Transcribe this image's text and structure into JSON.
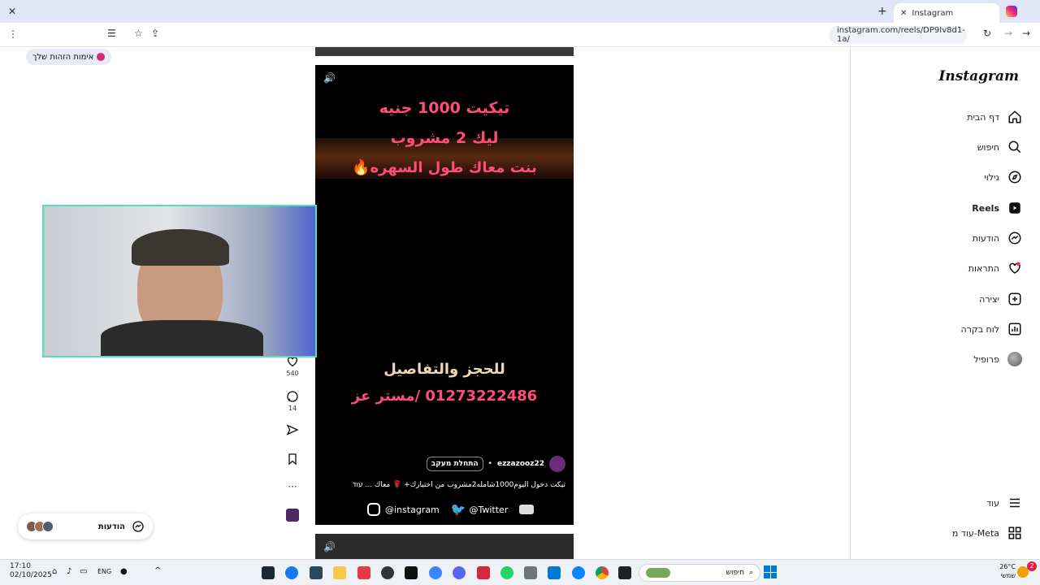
{
  "browser": {
    "tab_title": "Instagram",
    "url": "instagram.com/reels/DP9Iv8d1-1a/",
    "profile_chip": "אימות הזהות שלך"
  },
  "sidebar": {
    "logo": "Instagram",
    "items": [
      {
        "label": "דף הבית",
        "icon": "home-icon"
      },
      {
        "label": "חיפוש",
        "icon": "search-icon"
      },
      {
        "label": "גילוי",
        "icon": "compass-icon"
      },
      {
        "label": "Reels",
        "icon": "reels-icon"
      },
      {
        "label": "הודעות",
        "icon": "messenger-icon"
      },
      {
        "label": "התראות",
        "icon": "heart-icon"
      },
      {
        "label": "יצירה",
        "icon": "plus-square-icon"
      },
      {
        "label": "לוח בקרה",
        "icon": "dashboard-icon"
      },
      {
        "label": "פרופיל",
        "icon": "avatar-icon"
      }
    ],
    "bottom": [
      {
        "label": "עוד",
        "icon": "menu-icon"
      },
      {
        "label": "עוד מ-Meta",
        "icon": "meta-grid-icon"
      }
    ]
  },
  "reel": {
    "overlay_lines": [
      "تيكيت 1000 جنيه",
      "ليك 2 مشروب",
      "بنت معاك طول السهره🔥"
    ],
    "overlay_bottom": [
      "للحجز والتفاصيل",
      "01273222486 /مستر عز"
    ],
    "username": "ezzazooz22",
    "follow_label": "התחלת מעקב",
    "caption": "تيكت دخول اليوم1000شامله2مشروب من اختيارك+ 🌹 معاك ... עוד",
    "social_instagram": "@instagram",
    "social_twitter": "@Twitter"
  },
  "actions": {
    "likes": "540",
    "comments": "14"
  },
  "messages_bar": {
    "label": "הודעות"
  },
  "taskbar": {
    "time": "17:10",
    "date": "02/10/2025",
    "lang": "ENG",
    "search": "חיפוש",
    "weather": "26°C",
    "weather_label": "שמשי",
    "badge": "2"
  }
}
